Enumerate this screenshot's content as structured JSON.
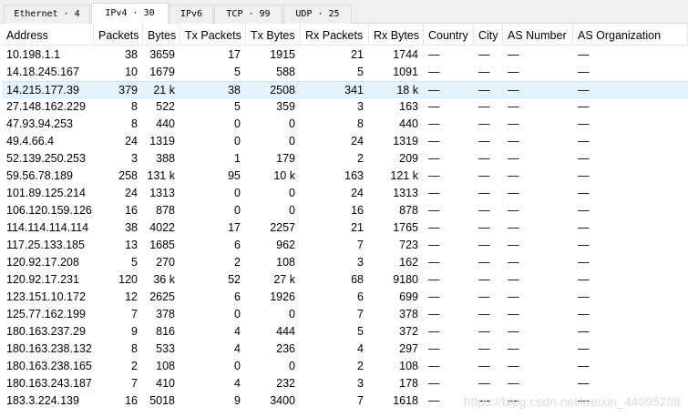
{
  "tabs": [
    {
      "label": "Ethernet · 4",
      "active": false
    },
    {
      "label": "IPv4 · 30",
      "active": true
    },
    {
      "label": "IPv6",
      "active": false
    },
    {
      "label": "TCP · 99",
      "active": false
    },
    {
      "label": "UDP · 25",
      "active": false
    }
  ],
  "columns": [
    "Address",
    "Packets",
    "Bytes",
    "Tx Packets",
    "Tx Bytes",
    "Rx Packets",
    "Rx Bytes",
    "Country",
    "City",
    "AS Number",
    "AS Organization"
  ],
  "sort_indicator": "^",
  "selected_row": 2,
  "rows": [
    [
      "10.198.1.1",
      "38",
      "3659",
      "17",
      "1915",
      "21",
      "1744",
      "—",
      "—",
      "—",
      "—"
    ],
    [
      "14.18.245.167",
      "10",
      "1679",
      "5",
      "588",
      "5",
      "1091",
      "—",
      "—",
      "—",
      "—"
    ],
    [
      "14.215.177.39",
      "379",
      "21 k",
      "38",
      "2508",
      "341",
      "18 k",
      "—",
      "—",
      "—",
      "—"
    ],
    [
      "27.148.162.229",
      "8",
      "522",
      "5",
      "359",
      "3",
      "163",
      "—",
      "—",
      "—",
      "—"
    ],
    [
      "47.93.94.253",
      "8",
      "440",
      "0",
      "0",
      "8",
      "440",
      "—",
      "—",
      "—",
      "—"
    ],
    [
      "49.4.66.4",
      "24",
      "1319",
      "0",
      "0",
      "24",
      "1319",
      "—",
      "—",
      "—",
      "—"
    ],
    [
      "52.139.250.253",
      "3",
      "388",
      "1",
      "179",
      "2",
      "209",
      "—",
      "—",
      "—",
      "—"
    ],
    [
      "59.56.78.189",
      "258",
      "131 k",
      "95",
      "10 k",
      "163",
      "121 k",
      "—",
      "—",
      "—",
      "—"
    ],
    [
      "101.89.125.214",
      "24",
      "1313",
      "0",
      "0",
      "24",
      "1313",
      "—",
      "—",
      "—",
      "—"
    ],
    [
      "106.120.159.126",
      "16",
      "878",
      "0",
      "0",
      "16",
      "878",
      "—",
      "—",
      "—",
      "—"
    ],
    [
      "114.114.114.114",
      "38",
      "4022",
      "17",
      "2257",
      "21",
      "1765",
      "—",
      "—",
      "—",
      "—"
    ],
    [
      "117.25.133.185",
      "13",
      "1685",
      "6",
      "962",
      "7",
      "723",
      "—",
      "—",
      "—",
      "—"
    ],
    [
      "120.92.17.208",
      "5",
      "270",
      "2",
      "108",
      "3",
      "162",
      "—",
      "—",
      "—",
      "—"
    ],
    [
      "120.92.17.231",
      "120",
      "36 k",
      "52",
      "27 k",
      "68",
      "9180",
      "—",
      "—",
      "—",
      "—"
    ],
    [
      "123.151.10.172",
      "12",
      "2625",
      "6",
      "1926",
      "6",
      "699",
      "—",
      "—",
      "—",
      "—"
    ],
    [
      "125.77.162.199",
      "7",
      "378",
      "0",
      "0",
      "7",
      "378",
      "—",
      "—",
      "—",
      "—"
    ],
    [
      "180.163.237.29",
      "9",
      "816",
      "4",
      "444",
      "5",
      "372",
      "—",
      "—",
      "—",
      "—"
    ],
    [
      "180.163.238.132",
      "8",
      "533",
      "4",
      "236",
      "4",
      "297",
      "—",
      "—",
      "—",
      "—"
    ],
    [
      "180.163.238.165",
      "2",
      "108",
      "0",
      "0",
      "2",
      "108",
      "—",
      "—",
      "—",
      "—"
    ],
    [
      "180.163.243.187",
      "7",
      "410",
      "4",
      "232",
      "3",
      "178",
      "—",
      "—",
      "—",
      "—"
    ],
    [
      "183.3.224.139",
      "16",
      "5018",
      "9",
      "3400",
      "7",
      "1618",
      "—",
      "—",
      "—",
      "—"
    ]
  ],
  "watermark": "https://blog.csdn.net/weixin_44095208"
}
